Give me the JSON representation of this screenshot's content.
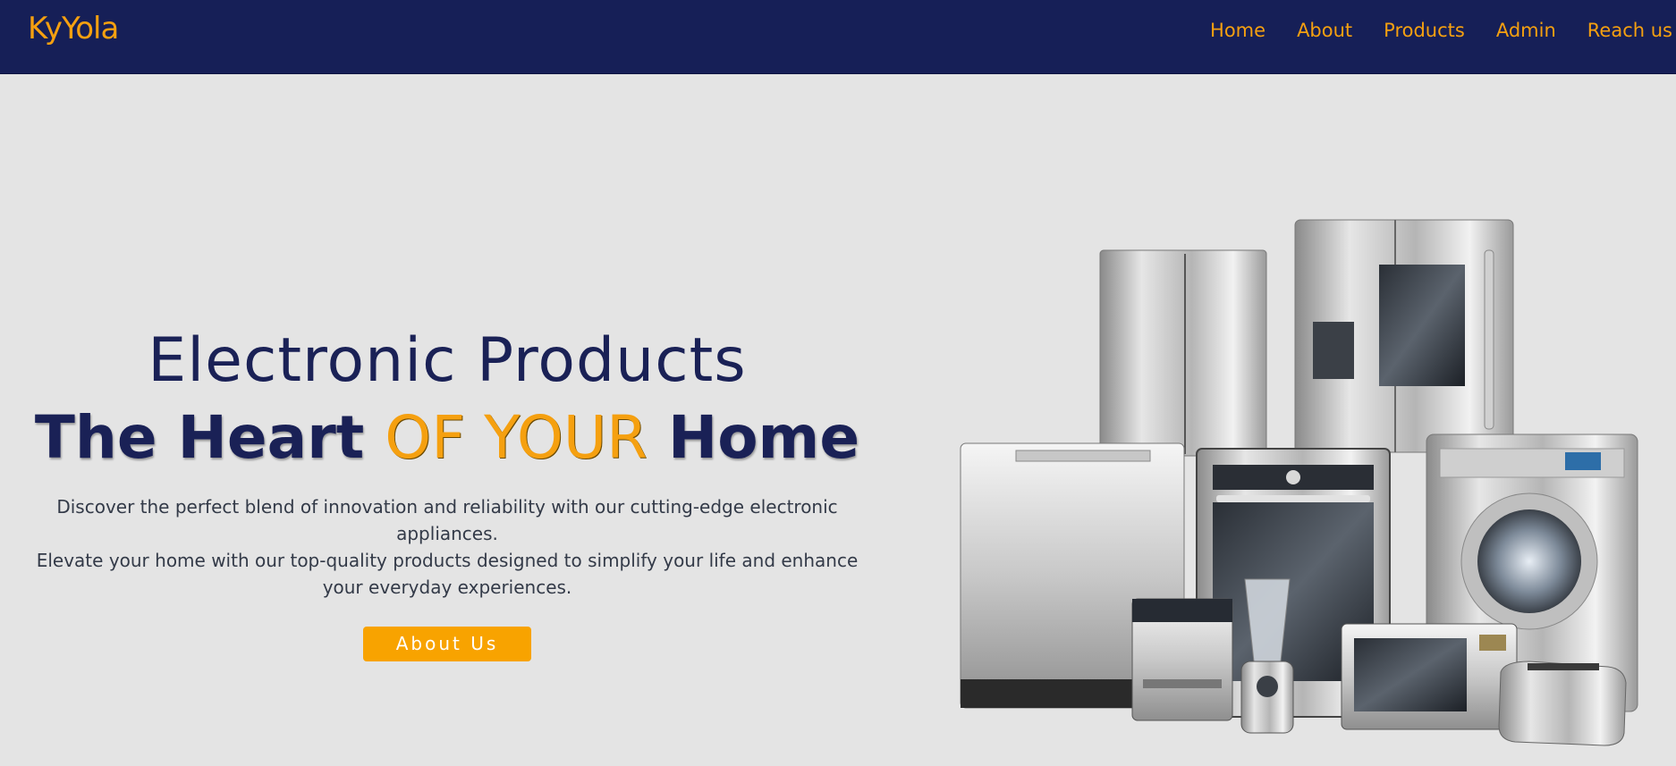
{
  "brand": {
    "logo_text": "KyYola"
  },
  "nav": {
    "items": [
      {
        "label": "Home"
      },
      {
        "label": "About"
      },
      {
        "label": "Products"
      },
      {
        "label": "Admin"
      },
      {
        "label": "Reach us"
      }
    ]
  },
  "hero": {
    "title_line1": "Electronic Products",
    "title_part1": "The Heart ",
    "title_accent": "OF YOUR",
    "title_part3": " Home",
    "description_1": "Discover the perfect blend of innovation and reliability with our cutting-edge electronic appliances.",
    "description_2": "Elevate your home with our top-quality products designed to simplify your life and enhance your everyday experiences.",
    "cta_label": "About Us"
  },
  "colors": {
    "navbar_bg": "#161f57",
    "accent": "#f5a010",
    "page_bg": "#e4e4e4",
    "heading": "#1a2156"
  },
  "image": {
    "name": "home-appliances-group-image"
  }
}
